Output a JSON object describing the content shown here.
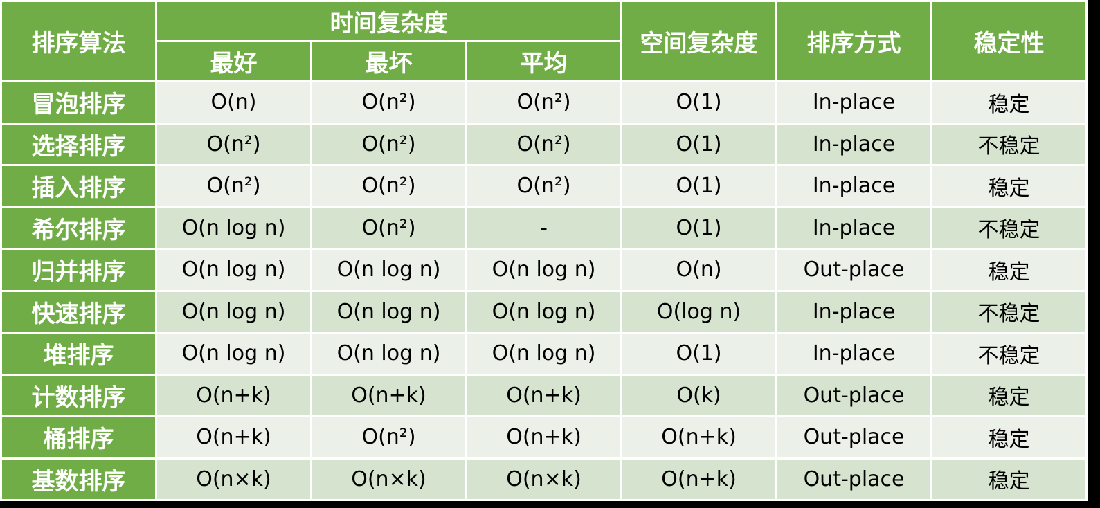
{
  "headers": {
    "algorithm": "排序算法",
    "time_complexity": "时间复杂度",
    "space_complexity": "空间复杂度",
    "sort_mode": "排序方式",
    "stability": "稳定性",
    "best": "最好",
    "worst": "最坏",
    "average": "平均"
  },
  "rows": [
    {
      "name": "冒泡排序",
      "best": "O(n)",
      "worst": "O(n²)",
      "average": "O(n²)",
      "space": "O(1)",
      "mode": "In-place",
      "stability": "稳定"
    },
    {
      "name": "选择排序",
      "best": "O(n²)",
      "worst": "O(n²)",
      "average": "O(n²)",
      "space": "O(1)",
      "mode": "In-place",
      "stability": "不稳定"
    },
    {
      "name": "插入排序",
      "best": "O(n²)",
      "worst": "O(n²)",
      "average": "O(n²)",
      "space": "O(1)",
      "mode": "In-place",
      "stability": "稳定"
    },
    {
      "name": "希尔排序",
      "best": "O(n log n)",
      "worst": "O(n²)",
      "average": "-",
      "space": "O(1)",
      "mode": "In-place",
      "stability": "不稳定"
    },
    {
      "name": "归并排序",
      "best": "O(n log n)",
      "worst": "O(n log n)",
      "average": "O(n log n)",
      "space": "O(n)",
      "mode": "Out-place",
      "stability": "稳定"
    },
    {
      "name": "快速排序",
      "best": "O(n log n)",
      "worst": "O(n log n)",
      "average": "O(n log n)",
      "space": "O(log n)",
      "mode": "In-place",
      "stability": "不稳定"
    },
    {
      "name": "堆排序",
      "best": "O(n log n)",
      "worst": "O(n log n)",
      "average": "O(n log n)",
      "space": "O(1)",
      "mode": "In-place",
      "stability": "不稳定"
    },
    {
      "name": "计数排序",
      "best": "O(n+k)",
      "worst": "O(n+k)",
      "average": "O(n+k)",
      "space": "O(k)",
      "mode": "Out-place",
      "stability": "稳定"
    },
    {
      "name": "桶排序",
      "best": "O(n+k)",
      "worst": "O(n²)",
      "average": "O(n+k)",
      "space": "O(n+k)",
      "mode": "Out-place",
      "stability": "稳定"
    },
    {
      "name": "基数排序",
      "best": "O(n×k)",
      "worst": "O(n×k)",
      "average": "O(n×k)",
      "space": "O(n+k)",
      "mode": "Out-place",
      "stability": "稳定"
    }
  ],
  "colors": {
    "header_bg": "#70ad47",
    "row_light": "#ebf1e9",
    "row_dark": "#d5e3cf",
    "border": "#ffffff"
  }
}
